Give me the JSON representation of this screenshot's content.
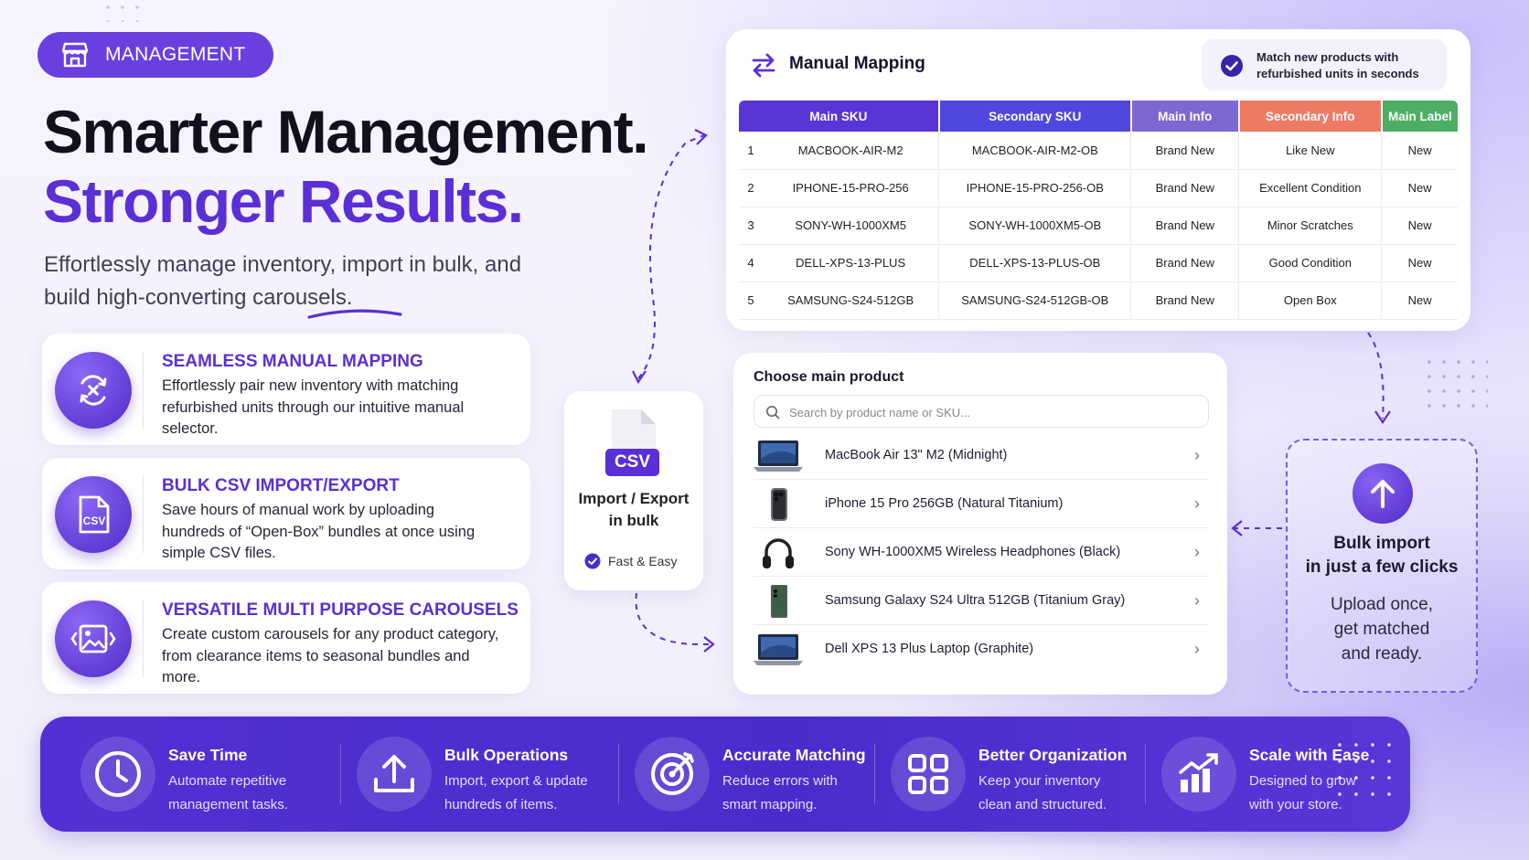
{
  "badge": {
    "label": "MANAGEMENT",
    "icon": "store-icon"
  },
  "headline": {
    "line1": "Smarter Management.",
    "line2": "Stronger Results."
  },
  "subtitle": "Effortlessly manage inventory, import in bulk, and build high-converting carousels.",
  "features": [
    {
      "icon": "sync-icon",
      "title": "SEAMLESS MANUAL MAPPING",
      "text": "Effortlessly pair new inventory with matching refurbished units through our intuitive manual selector."
    },
    {
      "icon": "csv-file-icon",
      "title": "BULK CSV IMPORT/EXPORT",
      "text": "Save hours of manual work by uploading hundreds of “Open-Box” bundles at once using simple CSV files."
    },
    {
      "icon": "image-carousel-icon",
      "title": "VERSATILE MULTI PURPOSE CAROUSELS",
      "text": "Create custom carousels for any product category, from clearance items to seasonal bundles and more."
    }
  ],
  "mapping": {
    "title": "Manual Mapping",
    "match_text": "Match new products with refurbished units in seconds",
    "columns": [
      "Main SKU",
      "Secondary SKU",
      "Main Info",
      "Secondary Info",
      "Main Label"
    ],
    "column_colors": [
      "#5a35d6",
      "#4f47e0",
      "#7d68d2",
      "#ef7a64",
      "#4caf63"
    ],
    "rows": [
      {
        "n": "1",
        "main": "MACBOOK-AIR-M2",
        "secondary": "MACBOOK-AIR-M2-OB",
        "main_info": "Brand New",
        "secondary_info": "Like New",
        "label": "New"
      },
      {
        "n": "2",
        "main": "IPHONE-15-PRO-256",
        "secondary": "IPHONE-15-PRO-256-OB",
        "main_info": "Brand New",
        "secondary_info": "Excellent Condition",
        "label": "New"
      },
      {
        "n": "3",
        "main": "SONY-WH-1000XM5",
        "secondary": "SONY-WH-1000XM5-OB",
        "main_info": "Brand New",
        "secondary_info": "Minor Scratches",
        "label": "New"
      },
      {
        "n": "4",
        "main": "DELL-XPS-13-PLUS",
        "secondary": "DELL-XPS-13-PLUS-OB",
        "main_info": "Brand New",
        "secondary_info": "Good Condition",
        "label": "New"
      },
      {
        "n": "5",
        "main": "SAMSUNG-S24-512GB",
        "secondary": "SAMSUNG-S24-512GB-OB",
        "main_info": "Brand New",
        "secondary_info": "Open Box",
        "label": "New"
      }
    ]
  },
  "csv_card": {
    "tag": "CSV",
    "label_line1": "Import / Export",
    "label_line2": "in bulk",
    "note": "Fast & Easy"
  },
  "chooser": {
    "title": "Choose main product",
    "search_placeholder": "Search by product name or SKU...",
    "products": [
      {
        "name": "MacBook Air 13\" M2 (Midnight)",
        "icon": "laptop-icon"
      },
      {
        "name": "iPhone 15 Pro 256GB (Natural Titanium)",
        "icon": "phone-icon"
      },
      {
        "name": "Sony WH-1000XM5 Wireless Headphones (Black)",
        "icon": "headphones-icon"
      },
      {
        "name": "Samsung Galaxy S24 Ultra 512GB (Titanium Gray)",
        "icon": "phone-icon"
      },
      {
        "name": "Dell XPS 13 Plus Laptop (Graphite)",
        "icon": "laptop-icon"
      }
    ]
  },
  "bulk": {
    "title_line1": "Bulk import",
    "title_line2": "in just a few clicks",
    "desc_line1": "Upload once,",
    "desc_line2": "get matched",
    "desc_line3": "and ready."
  },
  "benefits": [
    {
      "icon": "clock-icon",
      "title": "Save Time",
      "text": "Automate repetitive management tasks."
    },
    {
      "icon": "upload-icon",
      "title": "Bulk Operations",
      "text": "Import, export & update hundreds of items."
    },
    {
      "icon": "target-icon",
      "title": "Accurate Matching",
      "text": "Reduce errors with smart mapping."
    },
    {
      "icon": "grid-icon",
      "title": "Better Organization",
      "text": "Keep your inventory clean and structured."
    },
    {
      "icon": "growth-chart-icon",
      "title": "Scale with Ease",
      "text": "Designed to grow with your store."
    }
  ]
}
